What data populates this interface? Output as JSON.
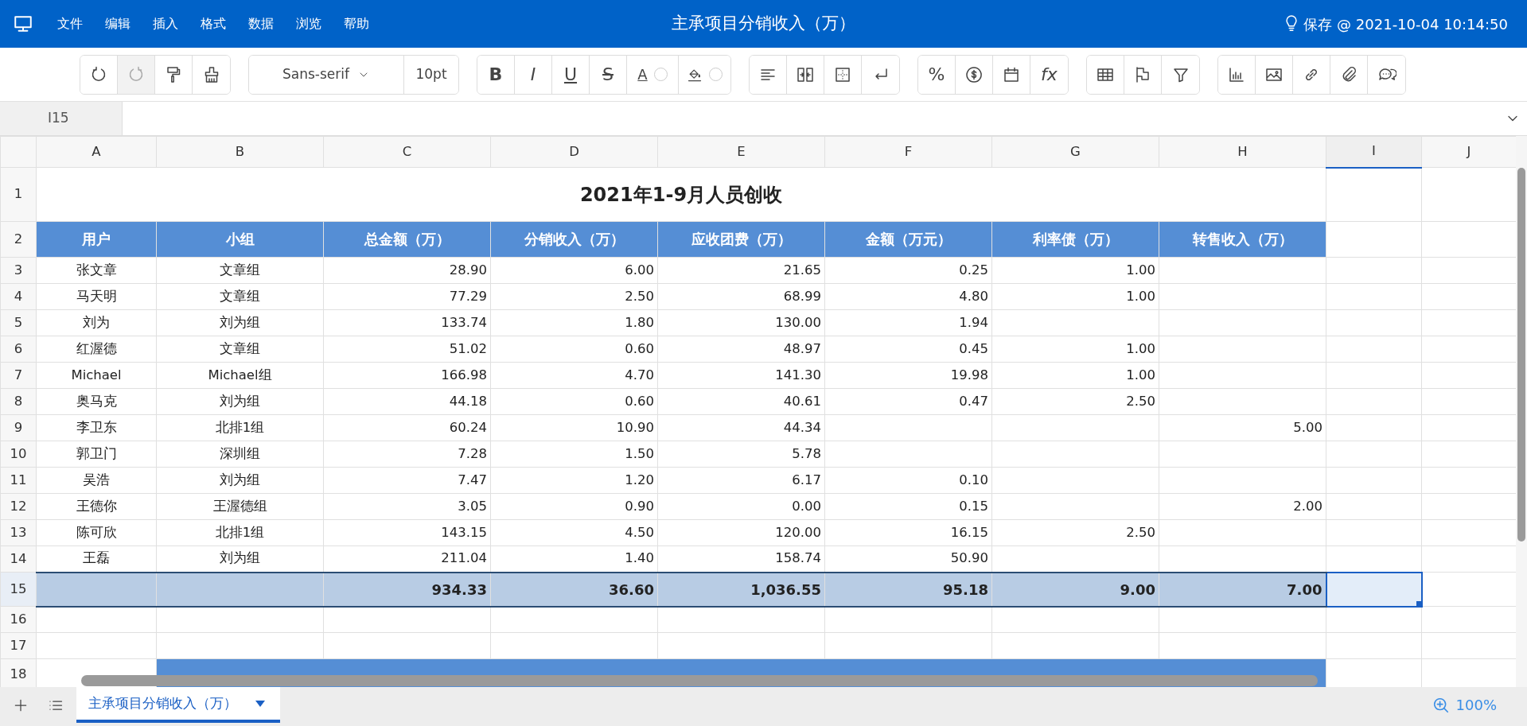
{
  "menubar": {
    "items": [
      "文件",
      "编辑",
      "插入",
      "格式",
      "数据",
      "浏览",
      "帮助"
    ],
    "title": "主承项目分销收入（万）",
    "save_status": "保存 @ 2021-10-04 10:14:50"
  },
  "toolbar": {
    "groups": [
      {
        "items": [
          {
            "kind": "icon",
            "disabled": false
          },
          {
            "kind": "icon",
            "disabled": true
          },
          {
            "kind": "icon",
            "disabled": false
          },
          {
            "kind": "icon",
            "disabled": false
          }
        ]
      },
      {
        "items": [
          {
            "kind": "select",
            "text": "Sans-serif"
          },
          {
            "kind": "size",
            "text": "10pt"
          }
        ]
      },
      {
        "items": [
          {
            "kind": "text",
            "text": "B"
          },
          {
            "kind": "text",
            "text": "I"
          },
          {
            "kind": "text",
            "text": "U"
          },
          {
            "kind": "text",
            "text": "S"
          },
          {
            "kind": "color",
            "text": "A"
          },
          {
            "kind": "color"
          }
        ]
      },
      {
        "items": [
          {
            "kind": "icon"
          },
          {
            "kind": "icon"
          },
          {
            "kind": "icon"
          },
          {
            "kind": "icon"
          }
        ]
      },
      {
        "items": [
          {
            "kind": "text",
            "text": "%"
          },
          {
            "kind": "icon"
          },
          {
            "kind": "icon"
          },
          {
            "kind": "text",
            "text": "fx"
          }
        ]
      },
      {
        "items": [
          {
            "kind": "icon"
          },
          {
            "kind": "icon"
          },
          {
            "kind": "icon"
          }
        ]
      },
      {
        "items": [
          {
            "kind": "icon"
          },
          {
            "kind": "icon"
          },
          {
            "kind": "icon"
          },
          {
            "kind": "icon"
          },
          {
            "kind": "icon"
          }
        ]
      }
    ]
  },
  "formula_bar": {
    "cell_ref": "I15"
  },
  "columns": [
    {
      "label": "A",
      "selected": false
    },
    {
      "label": "B",
      "selected": false
    },
    {
      "label": "C",
      "selected": false
    },
    {
      "label": "D",
      "selected": false
    },
    {
      "label": "E",
      "selected": false
    },
    {
      "label": "F",
      "selected": false
    },
    {
      "label": "G",
      "selected": false
    },
    {
      "label": "H",
      "selected": false
    },
    {
      "label": "I",
      "selected": true
    },
    {
      "label": "J",
      "selected": false
    }
  ],
  "rows": [
    {
      "number": "1",
      "kind": "title",
      "selected": false,
      "text": "2021年1-9月人员创收"
    },
    {
      "number": "2",
      "kind": "header",
      "selected": false,
      "cells": [
        "用户",
        "小组",
        "总金额（万）",
        "分销收入（万）",
        "应收团费（万）",
        "金额（万元）",
        "利率债（万）",
        "转售收入（万）"
      ]
    },
    {
      "number": "3",
      "kind": "data",
      "selected": false,
      "cells": [
        "张文章",
        "文章组",
        "28.90",
        "6.00",
        "21.65",
        "0.25",
        "1.00",
        null
      ]
    },
    {
      "number": "4",
      "kind": "data",
      "selected": false,
      "cells": [
        "马天明",
        "文章组",
        "77.29",
        "2.50",
        "68.99",
        "4.80",
        "1.00",
        null
      ]
    },
    {
      "number": "5",
      "kind": "data",
      "selected": false,
      "cells": [
        "刘为",
        "刘为组",
        "133.74",
        "1.80",
        "130.00",
        "1.94",
        null,
        null
      ]
    },
    {
      "number": "6",
      "kind": "data",
      "selected": false,
      "cells": [
        "红渥德",
        "文章组",
        "51.02",
        "0.60",
        "48.97",
        "0.45",
        "1.00",
        null
      ]
    },
    {
      "number": "7",
      "kind": "data",
      "selected": false,
      "cells": [
        "Michael",
        "Michael组",
        "166.98",
        "4.70",
        "141.30",
        "19.98",
        "1.00",
        null
      ]
    },
    {
      "number": "8",
      "kind": "data",
      "selected": false,
      "cells": [
        "奥马克",
        "刘为组",
        "44.18",
        "0.60",
        "40.61",
        "0.47",
        "2.50",
        null
      ]
    },
    {
      "number": "9",
      "kind": "data",
      "selected": false,
      "cells": [
        "李卫东",
        "北排1组",
        "60.24",
        "10.90",
        "44.34",
        null,
        null,
        "5.00"
      ]
    },
    {
      "number": "10",
      "kind": "data",
      "selected": false,
      "cells": [
        "郭卫门",
        "深圳组",
        "7.28",
        "1.50",
        "5.78",
        null,
        null,
        null
      ]
    },
    {
      "number": "11",
      "kind": "data",
      "selected": false,
      "cells": [
        "吴浩",
        "刘为组",
        "7.47",
        "1.20",
        "6.17",
        "0.10",
        null,
        null
      ]
    },
    {
      "number": "12",
      "kind": "data",
      "selected": false,
      "cells": [
        "王德你",
        "王渥德组",
        "3.05",
        "0.90",
        "0.00",
        "0.15",
        null,
        "2.00"
      ]
    },
    {
      "number": "13",
      "kind": "data",
      "selected": false,
      "cells": [
        "陈可欣",
        "北排1组",
        "143.15",
        "4.50",
        "120.00",
        "16.15",
        "2.50",
        null
      ]
    },
    {
      "number": "14",
      "kind": "data",
      "selected": false,
      "cells": [
        "王磊",
        "刘为组",
        "211.04",
        "1.40",
        "158.74",
        "50.90",
        null,
        null
      ]
    },
    {
      "number": "15",
      "kind": "total",
      "selected": true,
      "cells": [
        null,
        null,
        "934.33",
        "36.60",
        "1,036.55",
        "95.18",
        "9.00",
        "7.00"
      ]
    },
    {
      "number": "16",
      "kind": "empty",
      "selected": false
    },
    {
      "number": "17",
      "kind": "empty",
      "selected": false
    },
    {
      "number": "18",
      "kind": "band",
      "selected": false
    }
  ],
  "sheet_tabs": [
    {
      "label": "主承项目分销收入（万）",
      "selected": true
    }
  ],
  "zoom": "100%"
}
